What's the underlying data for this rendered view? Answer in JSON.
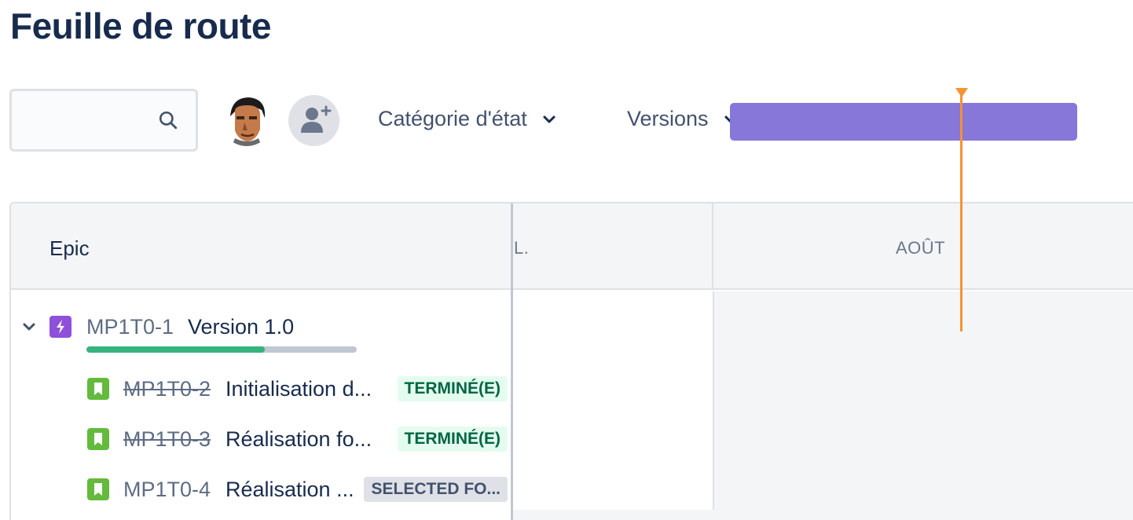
{
  "page": {
    "title": "Feuille de route"
  },
  "toolbar": {
    "search": {
      "value": "",
      "placeholder": "",
      "icon": "search-icon"
    },
    "filters": [
      {
        "label": "Catégorie d'état",
        "icon": "chevron-down-icon"
      },
      {
        "label": "Versions",
        "icon": "chevron-down-icon"
      }
    ],
    "add_person_icon": "add-person-icon"
  },
  "roadmap": {
    "header": {
      "epic_label": "Epic",
      "months": [
        "L.",
        "AOÛT"
      ]
    },
    "epic": {
      "key": "MP1T0-1",
      "summary": "Version 1.0",
      "progress_done_fraction": 0.66,
      "bar_color": "#8777d9",
      "icon": "lightning-icon"
    },
    "issues": [
      {
        "key": "MP1T0-2",
        "summary": "Initialisation d...",
        "status": "TERMINÉ(E)",
        "done": true
      },
      {
        "key": "MP1T0-3",
        "summary": "Réalisation fo...",
        "status": "TERMINÉ(E)",
        "done": true
      },
      {
        "key": "MP1T0-4",
        "summary": "Réalisation ...",
        "status": "SELECTED FO...",
        "done": false
      }
    ],
    "today_color": "#f79232"
  },
  "colors": {
    "epic_purple": "#8e4fd9",
    "story_green": "#63ba3c",
    "progress_green": "#36b37e"
  }
}
